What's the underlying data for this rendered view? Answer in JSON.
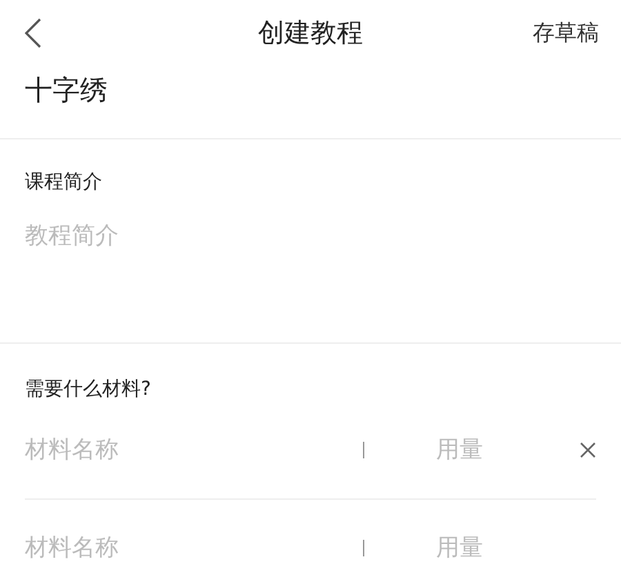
{
  "header": {
    "title": "创建教程",
    "action": "存草稿"
  },
  "course_name": "十字绣",
  "intro": {
    "label": "课程简介",
    "placeholder": "教程简介"
  },
  "materials": {
    "label": "需要什么材料?",
    "rows": [
      {
        "name_placeholder": "材料名称",
        "amount_placeholder": "用量",
        "deletable": true
      },
      {
        "name_placeholder": "材料名称",
        "amount_placeholder": "用量",
        "deletable": false
      }
    ]
  }
}
